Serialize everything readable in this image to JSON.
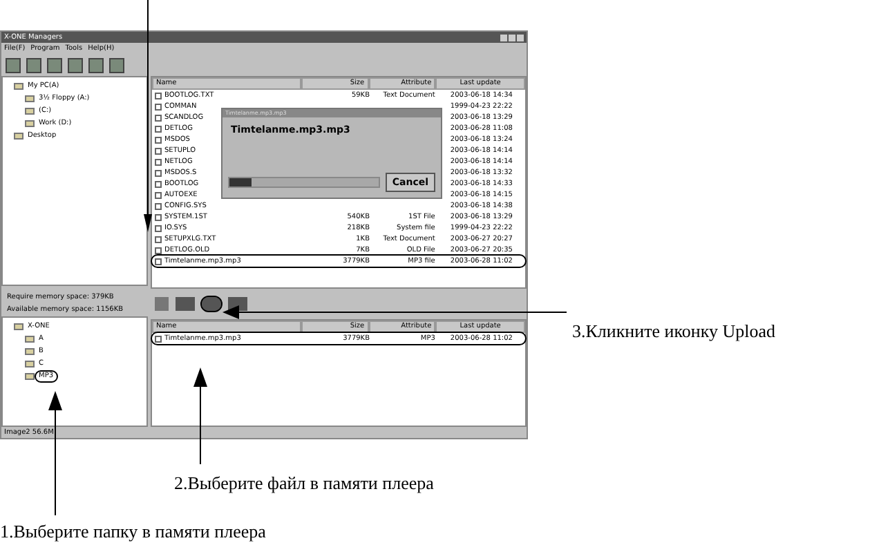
{
  "window": {
    "title": "X-ONE Managers",
    "menu": [
      "File(F)",
      "Program",
      "Tools",
      "Help(H)"
    ]
  },
  "pc_tree": [
    {
      "label": "My PC(A)",
      "children": [
        {
          "label": "3½ Floppy (A:)"
        },
        {
          "label": "(C:)"
        },
        {
          "label": "Work (D:)"
        }
      ]
    },
    {
      "label": "Desktop"
    }
  ],
  "pc_table": {
    "columns": [
      "Name",
      "Size",
      "Attribute",
      "Last update"
    ],
    "rows": [
      {
        "name": "BOOTLOG.TXT",
        "size": "59KB",
        "attribute": "Text Document",
        "updated": "2003-06-18 14:34",
        "selected": false
      },
      {
        "name": "COMMAN",
        "updated": "1999-04-23 22:22",
        "selected": false
      },
      {
        "name": "SCANDLOG",
        "updated": "2003-06-18 13:29",
        "selected": false
      },
      {
        "name": "DETLOG",
        "updated": "2003-06-28 11:08",
        "selected": false
      },
      {
        "name": "MSDOS",
        "updated": "2003-06-18 13:24",
        "selected": false
      },
      {
        "name": "SETUPLO",
        "updated": "2003-06-18 14:14",
        "selected": false
      },
      {
        "name": "NETLOG",
        "updated": "2003-06-18 14:14",
        "selected": false
      },
      {
        "name": "MSDOS.S",
        "updated": "2003-06-18 13:32",
        "selected": false
      },
      {
        "name": "BOOTLOG",
        "updated": "2003-06-18 14:33",
        "selected": false
      },
      {
        "name": "AUTOEXE",
        "updated": "2003-06-18 14:15",
        "selected": false
      },
      {
        "name": "CONFIG.SYS",
        "updated": "2003-06-18 14:38",
        "selected": false
      },
      {
        "name": "SYSTEM.1ST",
        "size": "540KB",
        "attribute": "1ST File",
        "updated": "2003-06-18 13:29",
        "selected": false
      },
      {
        "name": "IO.SYS",
        "size": "218KB",
        "attribute": "System file",
        "updated": "1999-04-23 22:22",
        "selected": false
      },
      {
        "name": "SETUPXLG.TXT",
        "size": "1KB",
        "attribute": "Text Document",
        "updated": "2003-06-27 20:27",
        "selected": false
      },
      {
        "name": "DETLOG.OLD",
        "size": "7KB",
        "attribute": "OLD File",
        "updated": "2003-06-27 20:35",
        "selected": false
      },
      {
        "name": "Timtelanme.mp3.mp3",
        "size": "3779KB",
        "attribute": "MP3 file",
        "updated": "2003-06-28 11:02",
        "selected": true
      }
    ]
  },
  "progress_dialog": {
    "title": "Timtelanme.mp3.mp3",
    "file": "Timtelanme.mp3.mp3",
    "level": 0.15,
    "cancel": "Cancel"
  },
  "memory": {
    "required": "Require memory space: 379KB",
    "available": "Available memory space: 1156KB"
  },
  "player_tree": [
    {
      "label": "X-ONE",
      "selected": false,
      "children": [
        {
          "label": "A",
          "selected": false
        },
        {
          "label": "B",
          "selected": false
        },
        {
          "label": "C",
          "selected": false
        },
        {
          "label": "MP3",
          "selected": true
        }
      ]
    }
  ],
  "player_table": {
    "columns": [
      "Name",
      "Size",
      "Attribute",
      "Last update"
    ],
    "rows": [
      {
        "name": "Timtelanme.mp3.mp3",
        "size": "3779KB",
        "attribute": "MP3",
        "updated": "2003-06-28 11:02",
        "selected": true
      }
    ]
  },
  "status_bar": "Image2  56.6M",
  "callouts": [
    "3.Кликните иконку Upload",
    "2.Выберите файл в памяти плеера",
    "1.Выберите папку в памяти плеера"
  ]
}
